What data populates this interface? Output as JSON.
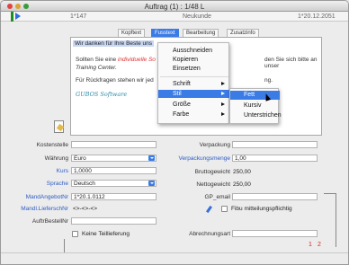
{
  "window": {
    "title": "Auftrag (1) : 1/48 L"
  },
  "header": {
    "left_number": "1*147",
    "mid_text": "Neukunde",
    "right_number": "1*20.12.2051"
  },
  "tabs": [
    "Kopftext",
    "Fusstext",
    "Bearbeitung",
    "Zusatzinfo"
  ],
  "editor": {
    "line1": "Wir danken für Ihre Beste uns",
    "line2_prefix": "Sollten Sie eine",
    "line2_colored": "individuelle So",
    "line2_suffix": "den Sie sich bitte an unser",
    "line3": "Training Center.",
    "line4_prefix": "Für Rückfragen stehen wir jed",
    "line4_suffix": "ng.",
    "signature": "GUBOS Software"
  },
  "context_menu": {
    "items": [
      "Ausschneiden",
      "Kopieren",
      "Einsetzen",
      "Schrift",
      "Stil",
      "Größe",
      "Farbe"
    ],
    "selected": "Stil"
  },
  "submenu": {
    "items": [
      "Fett",
      "Kursiv",
      "Unterstrichen"
    ],
    "selected": "Fett"
  },
  "form": {
    "kostenstelle_label": "Kostenstelle",
    "waehrung_label": "Währung",
    "waehrung_value": "Euro",
    "kurs_label": "Kurs",
    "kurs_value": "1,0000",
    "sprache_label": "Sprache",
    "sprache_value": "Deutsch",
    "mandangebot_label": "MandAngebotNr",
    "mandangebot_value": "1*20.1.0112",
    "mandlief_label": "Mandl.LieferschNr",
    "mandlief_value": "<>-<>-<>",
    "auftr_label": "AuftrBestellNr",
    "verpackung_label": "Verpackung",
    "verpackungsmenge_label": "Verpackungsmenge",
    "verpackungsmenge_value": "1,00",
    "bruttogewicht_label": "Bruttogewicht",
    "bruttogewicht_value": "250,00",
    "nettogewicht_label": "Nettogewicht",
    "nettogewicht_value": "250,00",
    "gpemail_label": "GP_email",
    "fibu_label": "Fibu mitteilungspflichtig",
    "keine_label": "Keine Teillieferung",
    "abrechnungsart_label": "Abrechnungsart",
    "teillieferung_label": "Keine Teillieferung"
  },
  "pager": {
    "page1": "1",
    "page2": "2"
  },
  "colors": {
    "accent": "#3a7be6",
    "label_blue": "#2d5cc4",
    "pager_red": "#d22"
  }
}
